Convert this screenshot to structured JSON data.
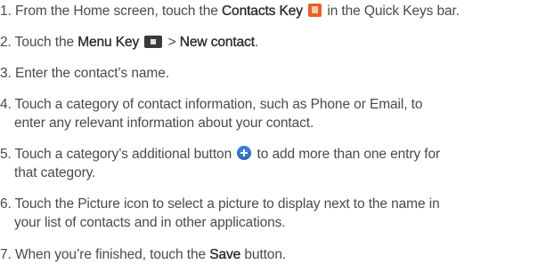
{
  "steps": [
    {
      "num": "1.",
      "parts": {
        "a": "From the Home screen, touch the ",
        "b": "Contacts Key",
        "c": " in the Quick Keys bar."
      },
      "icon": "contacts-key-icon"
    },
    {
      "num": "2.",
      "parts": {
        "a": "Touch the ",
        "b": "Menu Key",
        "c": " > ",
        "d": "New contact",
        "e": "."
      },
      "icon": "menu-key-icon"
    },
    {
      "num": "3.",
      "text": "Enter the contact’s name."
    },
    {
      "num": "4.",
      "line1": "Touch a category of contact information, such as Phone or Email, to",
      "line2": "enter any relevant information about your contact."
    },
    {
      "num": "5.",
      "line1a": "Touch a category’s additional button ",
      "line1b": " to add more than one entry for",
      "line2": "that category.",
      "icon": "add-plus-icon"
    },
    {
      "num": "6.",
      "line1": "Touch the Picture icon to select a picture to display next to the name in",
      "line2": "your list of contacts and in other applications."
    },
    {
      "num": "7.",
      "parts": {
        "a": "When you’re finished, touch the ",
        "b": "Save",
        "c": " button."
      }
    }
  ],
  "colors": {
    "text": "#4a4a4a",
    "contacts_icon": "#e8612a",
    "menu_icon": "#3b3b3b",
    "plus_icon": "#3a7cd8"
  }
}
